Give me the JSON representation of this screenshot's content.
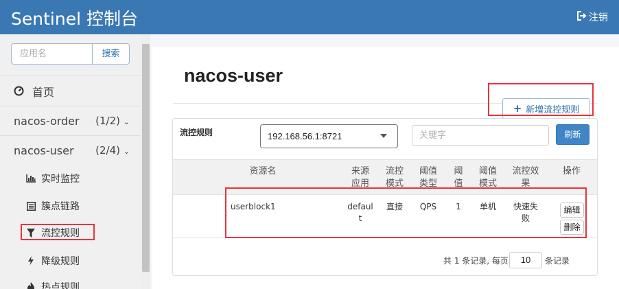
{
  "header": {
    "title": "Sentinel 控制台",
    "logout_label": "注销",
    "logout_icon": "sign-out-icon",
    "bg_color": "#3a78b3"
  },
  "sidebar": {
    "search_placeholder": "应用名",
    "search_button": "搜索",
    "home_label": "首页",
    "home_icon": "dashboard-icon",
    "apps": [
      {
        "name": "nacos-order",
        "count": "(1/2)",
        "expanded": false
      },
      {
        "name": "nacos-user",
        "count": "(2/4)",
        "expanded": true
      }
    ],
    "menu": [
      {
        "label": "实时监控",
        "icon": "bar-chart-icon"
      },
      {
        "label": "簇点链路",
        "icon": "list-icon"
      },
      {
        "label": "流控规则",
        "icon": "filter-icon",
        "active": true
      },
      {
        "label": "降级规则",
        "icon": "bolt-icon"
      },
      {
        "label": "热点规则",
        "icon": "fire-icon"
      }
    ]
  },
  "main": {
    "page_title": "nacos-user",
    "add_button": "新增流控规则",
    "panel_title": "流控规则",
    "machine_select": "192.168.56.1:8721",
    "keyword_placeholder": "关键字",
    "refresh_button": "刷新",
    "table": {
      "headers": {
        "resource": "资源名",
        "source_1": "来源",
        "source_2": "应用",
        "mode_1": "流控",
        "mode_2": "模式",
        "type_1": "阈值",
        "type_2": "类型",
        "count_1": "阈",
        "count_2": "值",
        "cluster_1": "阈值",
        "cluster_2": "模式",
        "effect_1": "流控效",
        "effect_2": "果",
        "actions": "操作"
      },
      "rows": [
        {
          "resource": "userblock1",
          "source_1": "defaul",
          "source_2": "t",
          "mode": "直接",
          "type": "QPS",
          "count": "1",
          "cluster": "单机",
          "effect_1": "快速失",
          "effect_2": "败",
          "edit": "编辑",
          "delete": "删除"
        }
      ]
    },
    "pagination": {
      "summary": "共 1 条记录, 每页",
      "page_size": "10",
      "suffix": "条记录"
    }
  },
  "highlight_color": "#e8333b"
}
